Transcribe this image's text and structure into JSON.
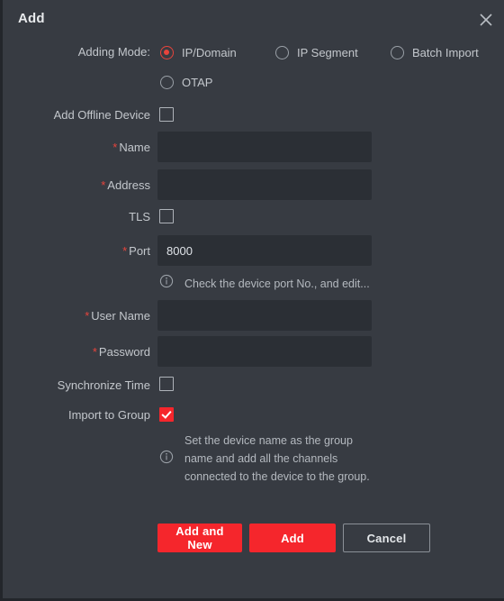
{
  "dialog": {
    "title": "Add",
    "close_icon": "close-icon"
  },
  "adding_mode": {
    "label": "Adding Mode:",
    "options": [
      {
        "label": "IP/Domain",
        "selected": true
      },
      {
        "label": "IP Segment",
        "selected": false
      },
      {
        "label": "Batch Import",
        "selected": false
      },
      {
        "label": "OTAP",
        "selected": false
      }
    ]
  },
  "fields": {
    "add_offline_device": {
      "label": "Add Offline Device",
      "checked": false
    },
    "name": {
      "label": "Name",
      "required": true,
      "value": "",
      "placeholder": ""
    },
    "address": {
      "label": "Address",
      "required": true,
      "value": "",
      "placeholder": ""
    },
    "tls": {
      "label": "TLS",
      "checked": false
    },
    "port": {
      "label": "Port",
      "required": true,
      "value": "8000",
      "placeholder": ""
    },
    "port_hint": "Check the device port No., and edit...",
    "user_name": {
      "label": "User Name",
      "required": true,
      "value": "",
      "placeholder": ""
    },
    "password": {
      "label": "Password",
      "required": true,
      "value": "",
      "placeholder": ""
    },
    "synchronize_time": {
      "label": "Synchronize Time",
      "checked": false
    },
    "import_to_group": {
      "label": "Import to Group",
      "checked": true
    },
    "import_hint": "Set the device name as the group\nname and add all the channels\nconnected to the device to the group."
  },
  "buttons": {
    "add_and_new": "Add and New",
    "add": "Add",
    "cancel": "Cancel"
  },
  "required_marker": "*",
  "colors": {
    "dialog_bg": "#373b42",
    "field_bg": "#2b2f35",
    "accent_red": "#f5262c",
    "required_red": "#e8443c",
    "text": "#c3c7cc"
  }
}
